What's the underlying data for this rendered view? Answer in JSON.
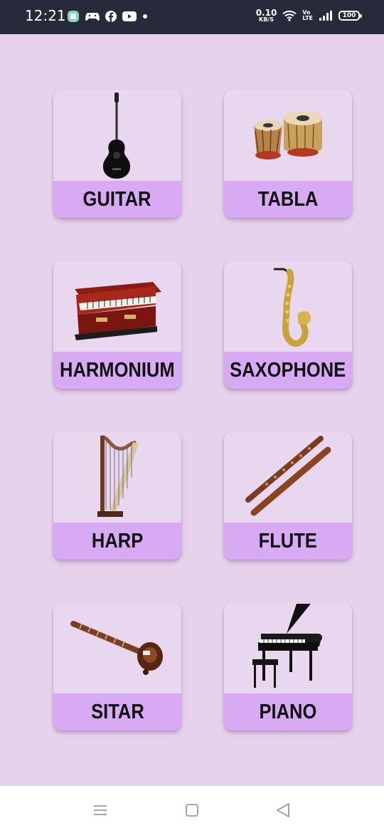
{
  "status_bar": {
    "time": "12:21",
    "icons_left": [
      "app-icon",
      "gamepad-icon",
      "facebook-icon",
      "youtube-icon",
      "dot-icon"
    ],
    "net_speed_value": "0.10",
    "net_speed_unit": "KB/S",
    "volte_top": "Vo",
    "volte_bottom": "LTE",
    "battery": "100"
  },
  "instruments": [
    {
      "label": "GUITAR",
      "icon": "guitar-icon"
    },
    {
      "label": "TABLA",
      "icon": "tabla-icon"
    },
    {
      "label": "HARMONIUM",
      "icon": "harmonium-icon"
    },
    {
      "label": "SAXOPHONE",
      "icon": "saxophone-icon"
    },
    {
      "label": "HARP",
      "icon": "harp-icon"
    },
    {
      "label": "FLUTE",
      "icon": "flute-icon"
    },
    {
      "label": "SITAR",
      "icon": "sitar-icon"
    },
    {
      "label": "PIANO",
      "icon": "piano-icon"
    }
  ],
  "nav_bar": {
    "buttons": [
      "menu-icon",
      "home-icon",
      "back-icon"
    ]
  },
  "colors": {
    "background": "#e6d2ec",
    "card_label": "#d7aaf3",
    "status_bar": "#262a3b"
  }
}
